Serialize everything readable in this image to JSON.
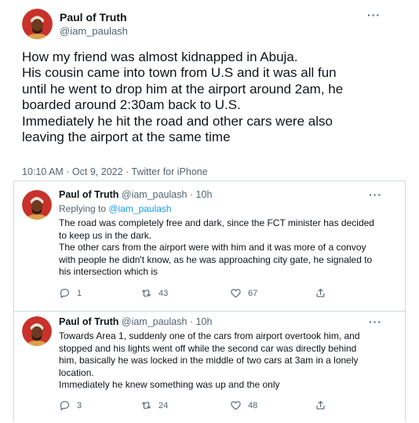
{
  "tweet": {
    "author_name": "Paul of Truth",
    "author_handle": "@iam_paulash",
    "lines": [
      "How my friend was almost kidnapped in Abuja.",
      "His cousin came into town from U.S and it was all fun",
      "until he went to drop him at the airport around 2am, he",
      "boarded around 2:30am back to U.S.",
      "Immediately he hit the road and other cars were also",
      "leaving the airport at the same time"
    ],
    "meta": "10:10 AM · Oct 9, 2022 · Twitter for iPhone",
    "more_icon": "more-horizontal-icon"
  },
  "replies": [
    {
      "name": "Paul of Truth",
      "handle_time": "@iam_paulash · 10h",
      "replying_prefix": "Replying to ",
      "replying_to": "@iam_paulash",
      "lines": [
        "The road was completely free and dark, since the FCT minister has decided",
        "to keep us in the dark.",
        "The other cars from the airport were with him and it was more of a convoy",
        "with people he didn't know, as he was approaching city gate, he signaled to",
        "his intersection which is"
      ],
      "replies_count": "1",
      "retweets_count": "43",
      "likes_count": "67"
    },
    {
      "name": "Paul of Truth",
      "handle_time": "@iam_paulash · 10h",
      "lines": [
        "Towards Area 1, suddenly one of the cars from airport overtook him, and",
        "stopped and his lights went off while the second car was directly behind",
        "him, basically he was locked in the middle of two cars at 3am in a lonely",
        "location.",
        "Immediately he knew something was up and the only"
      ],
      "replies_count": "3",
      "retweets_count": "24",
      "likes_count": "48"
    }
  ],
  "icons": {
    "reply": "reply-icon",
    "retweet": "retweet-icon",
    "like": "like-icon",
    "share": "share-icon"
  },
  "colors": {
    "link": "#1d9bf0",
    "secondary_text": "#536471",
    "border": "#cfd9de"
  }
}
